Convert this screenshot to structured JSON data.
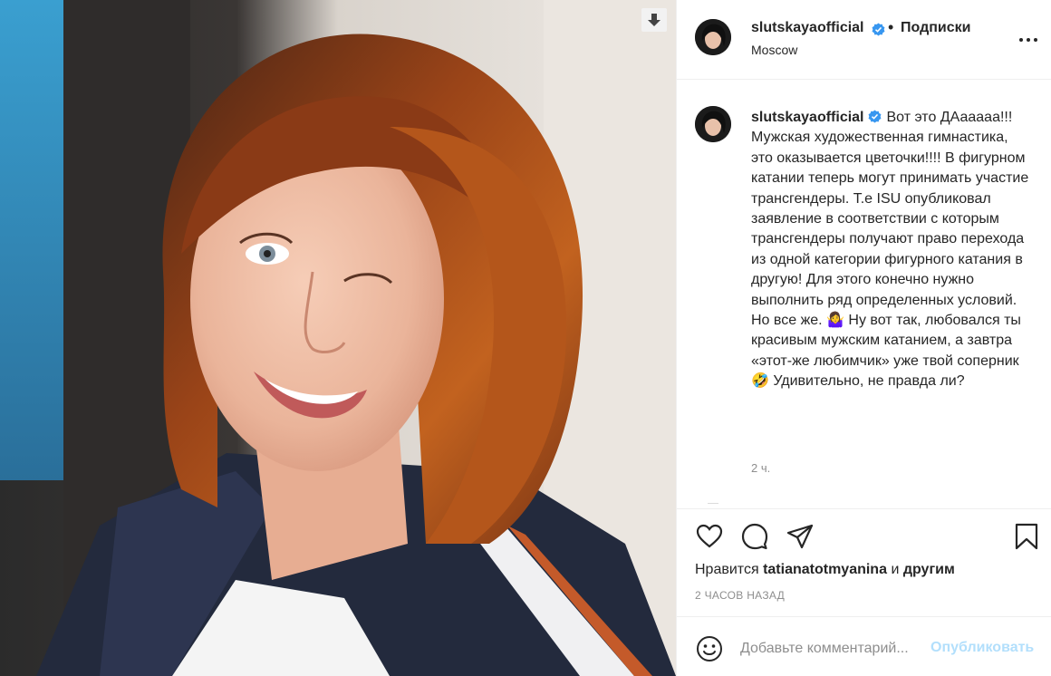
{
  "post": {
    "username": "slutskayaofficial",
    "follow_separator": "•",
    "follow_label": "Подписки",
    "location": "Moscow",
    "verified_icon": "verified-badge-icon",
    "more_icon": "more-options-icon"
  },
  "caption": {
    "username": "slutskayaofficial",
    "text_before_emoji1": "Вот это ДАааааа!!! Мужская художественная гимнастика, это оказывается цветочки!!!! В фигурном катании теперь могут принимать участие трансгендеры. Т.е ISU опубликовал заявление в соответствии с которым трансгендеры получают право перехода из одной категории фигурного катания в другую! Для этого конечно нужно выполнить ряд определенных условий. Но все же.",
    "emoji1": "🤷‍♀️",
    "text_between_emojis": " Ну вот так, любовался ты красивым мужским катанием, а завтра «этот-же любимчик» уже твой соперник",
    "emoji2": "🤣",
    "text_after_emoji2": " Удивительно, не правда ли?",
    "time": "2 ч."
  },
  "actions": {
    "like_icon": "heart-icon",
    "comment_icon": "comment-bubble-icon",
    "share_icon": "paper-plane-icon",
    "save_icon": "bookmark-icon"
  },
  "likes": {
    "prefix": "Нравится",
    "user": "tatianatotmyanina",
    "middle": "и",
    "others": "другим"
  },
  "timestamp": "2 ЧАСОВ НАЗАД",
  "comment_box": {
    "placeholder": "Добавьте комментарий...",
    "publish_label": "Опубликовать",
    "emoji_icon": "smiley-icon"
  },
  "colors": {
    "verified": "#3897f0",
    "publish_disabled": "#b2dffc",
    "secondary_text": "#8e8e8e",
    "border": "#efefef"
  }
}
